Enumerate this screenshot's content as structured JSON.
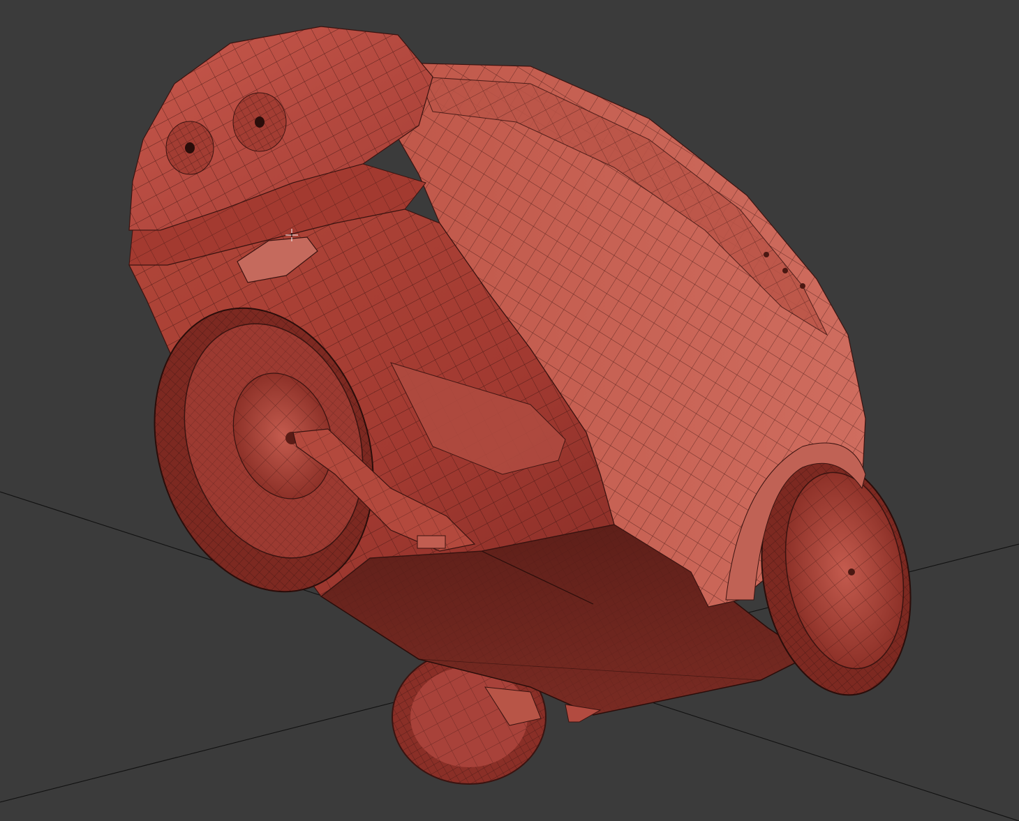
{
  "viewport": {
    "background": "#3b3b3b",
    "grid_line_color": "#111111"
  },
  "model": {
    "name_icon": "wireframe-shaded-vehicle",
    "shade_color": "#b54a40",
    "shade_dark": "#6b2620",
    "shade_light": "#cf6d5f",
    "wire_color": "#3a1310"
  },
  "cursor": {
    "icon": "crosshair-cursor-icon"
  }
}
